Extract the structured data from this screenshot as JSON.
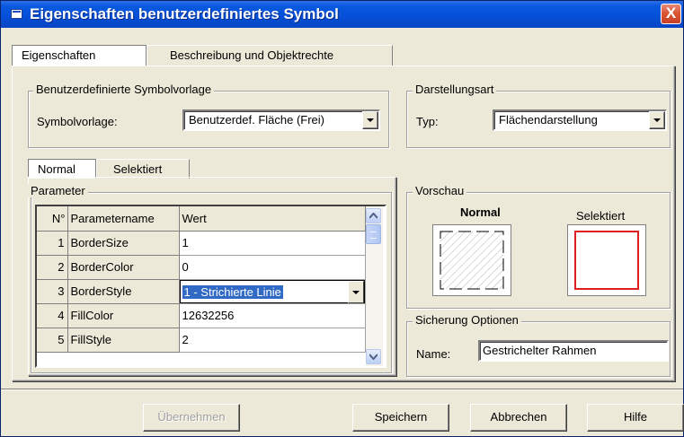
{
  "window": {
    "title": "Eigenschaften benutzerdefiniertes Symbol",
    "close_glyph": "X"
  },
  "tabs": [
    "Eigenschaften",
    "Beschreibung und Objektrechte"
  ],
  "symbolvorlage": {
    "group_label": "Benutzerdefinierte Symbolvorlage",
    "field_label": "Symbolvorlage:",
    "value": "Benutzerdef. Fläche (Frei)"
  },
  "darstellung": {
    "group_label": "Darstellungsart",
    "field_label": "Typ:",
    "value": "Flächendarstellung"
  },
  "subtabs": [
    "Normal",
    "Selektiert"
  ],
  "parameter": {
    "group_label": "Parameter",
    "columns": [
      "N°",
      "Parametername",
      "Wert"
    ],
    "rows": [
      {
        "n": "1",
        "name": "BorderSize",
        "value": "1"
      },
      {
        "n": "2",
        "name": "BorderColor",
        "value": "0"
      },
      {
        "n": "3",
        "name": "BorderStyle",
        "value": "1 - Strichierte Linie"
      },
      {
        "n": "4",
        "name": "FillColor",
        "value": "12632256"
      },
      {
        "n": "5",
        "name": "FillStyle",
        "value": "2"
      }
    ]
  },
  "vorschau": {
    "group_label": "Vorschau",
    "normal_label": "Normal",
    "selected_label": "Selektiert",
    "selected_border_color": "#e02020"
  },
  "sicherung": {
    "group_label": "Sicherung Optionen",
    "field_label": "Name:",
    "value": "Gestrichelter Rahmen"
  },
  "buttons": {
    "apply": "Übernehmen",
    "save": "Speichern",
    "cancel": "Abbrechen",
    "help": "Hilfe"
  }
}
